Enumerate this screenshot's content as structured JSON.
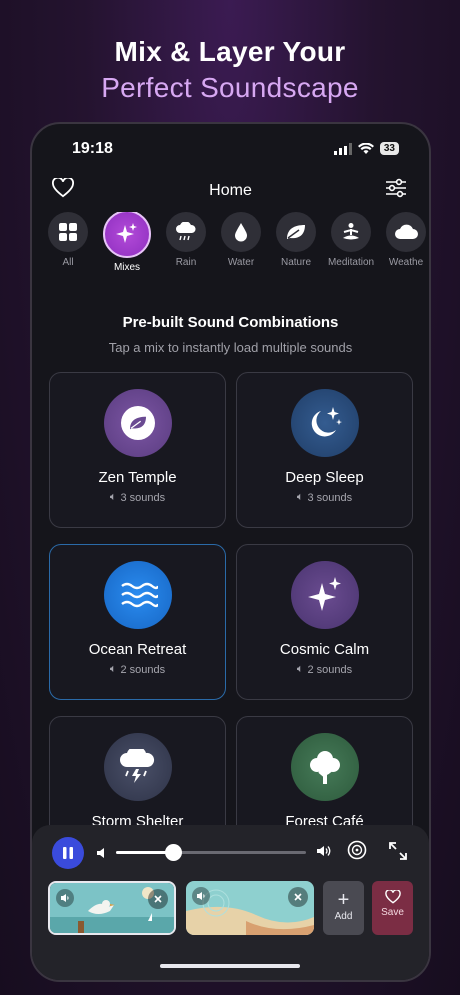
{
  "headline": {
    "line1": "Mix & Layer Your",
    "line2": "Perfect Soundscape"
  },
  "status": {
    "time": "19:18",
    "battery": "33"
  },
  "topbar": {
    "title": "Home",
    "favorites_icon": "heart-icon",
    "filters_icon": "sliders-icon"
  },
  "categories": [
    {
      "label": "All",
      "icon": "grid-icon"
    },
    {
      "label": "Mixes",
      "icon": "sparkles-icon",
      "active": true
    },
    {
      "label": "Rain",
      "icon": "rain-cloud-icon"
    },
    {
      "label": "Water",
      "icon": "drop-icon"
    },
    {
      "label": "Nature",
      "icon": "leaf-icon"
    },
    {
      "label": "Meditation",
      "icon": "meditation-icon"
    },
    {
      "label": "Weathe",
      "icon": "cloud-icon"
    }
  ],
  "section": {
    "title": "Pre-built Sound Combinations",
    "subtitle": "Tap a mix to instantly load multiple sounds"
  },
  "mixes": [
    {
      "name": "Zen Temple",
      "count": "3 sounds",
      "icon": "leaf-icon",
      "color": "#6d4a92"
    },
    {
      "name": "Deep Sleep",
      "count": "3 sounds",
      "icon": "moon-stars-icon",
      "color": "#2b4a78"
    },
    {
      "name": "Ocean Retreat",
      "count": "2 sounds",
      "icon": "waves-icon",
      "color": "#1f7ad6"
    },
    {
      "name": "Cosmic Calm",
      "count": "2 sounds",
      "icon": "sparkles-icon",
      "color": "#5a3f7c"
    },
    {
      "name": "Storm Shelter",
      "count": "",
      "icon": "thunder-cloud-icon",
      "color": "#3a3f55"
    },
    {
      "name": "Forest Café",
      "count": "",
      "icon": "tree-icon",
      "color": "#3a6a4a"
    }
  ],
  "player": {
    "volume": 0.3,
    "tracks": [
      {
        "name": "seagull-scene"
      },
      {
        "name": "sand-water-scene"
      }
    ],
    "add_label": "Add",
    "save_label": "Save"
  }
}
